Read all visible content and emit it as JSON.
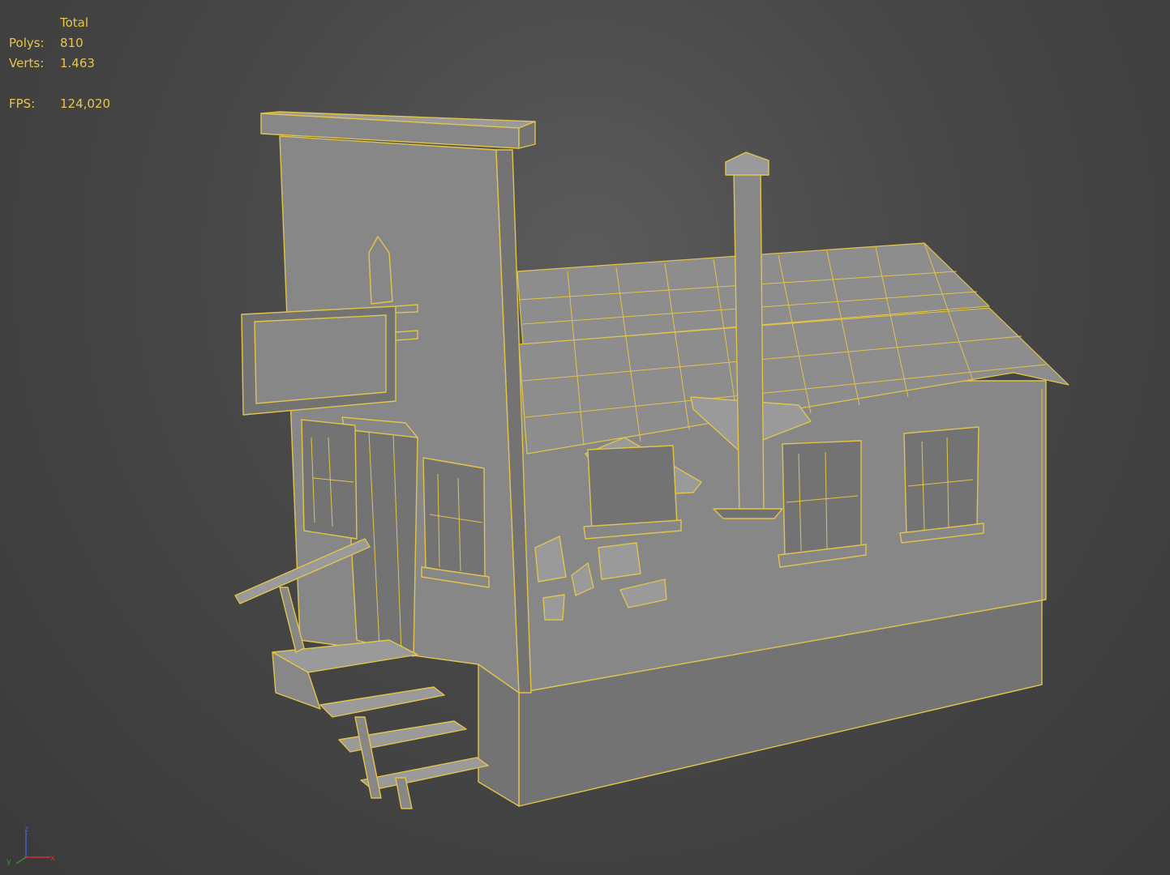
{
  "viewport": {
    "stats": {
      "header": "Total",
      "polys_label": "Polys:",
      "polys_value": "810",
      "verts_label": "Verts:",
      "verts_value": "1.463",
      "fps_label": "FPS:",
      "fps_value": "124,020"
    },
    "axis_gizmo": {
      "x_label": "x",
      "y_label": "y",
      "z_label": "z",
      "x_color": "#d63030",
      "y_color": "#3a8a3a",
      "z_color": "#4060d0"
    },
    "colors": {
      "wireframe": "#e2c44a",
      "stats_text": "#e6c64c",
      "background": "#474747",
      "mesh_fill": "#878787"
    },
    "model": "wooden-shack-mesh"
  }
}
